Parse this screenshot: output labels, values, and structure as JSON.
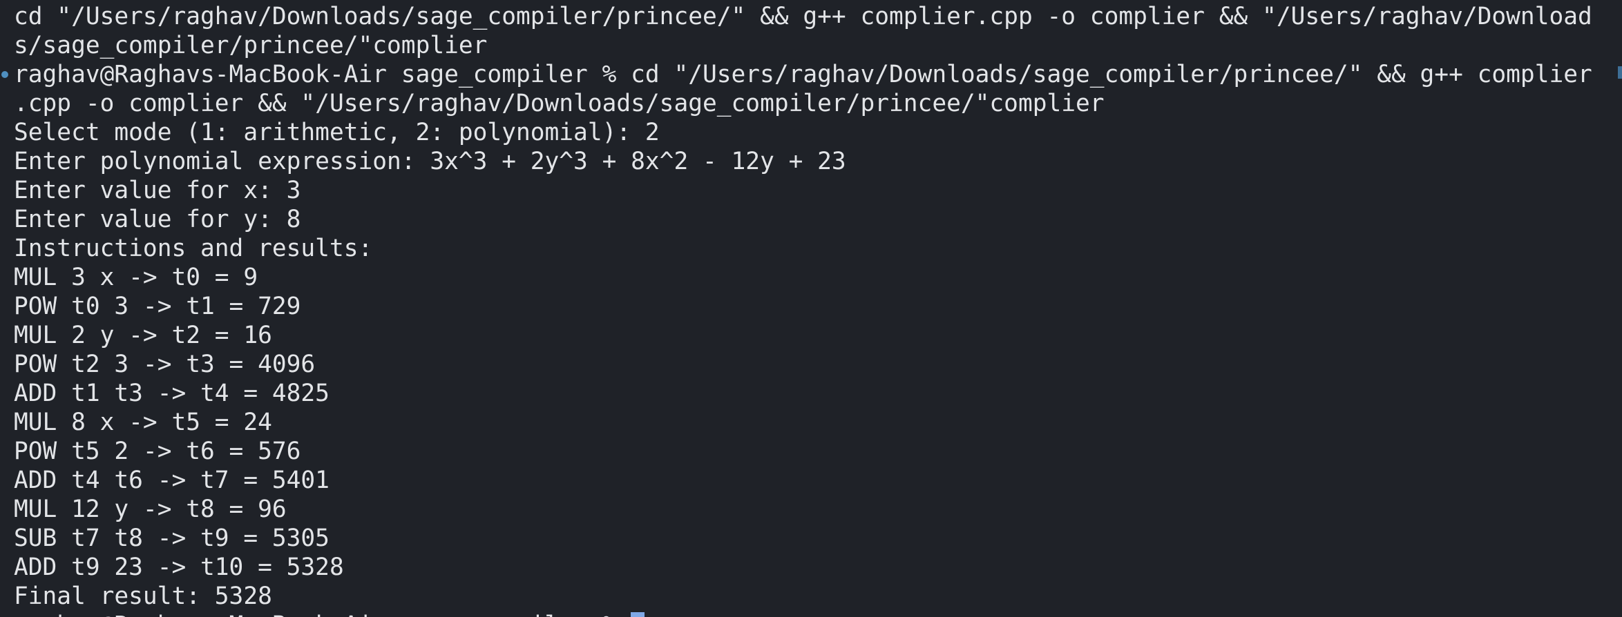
{
  "terminal": {
    "lines": [
      "cd \"/Users/raghav/Downloads/sage_compiler/princee/\" && g++ complier.cpp -o complier && \"/Users/raghav/Download",
      "s/sage_compiler/princee/\"complier",
      "raghav@Raghavs-MacBook-Air sage_compiler % cd \"/Users/raghav/Downloads/sage_compiler/princee/\" && g++ complier",
      ".cpp -o complier && \"/Users/raghav/Downloads/sage_compiler/princee/\"complier",
      "Select mode (1: arithmetic, 2: polynomial): 2",
      "Enter polynomial expression: 3x^3 + 2y^3 + 8x^2 - 12y + 23",
      "Enter value for x: 3",
      "Enter value for y: 8",
      "Instructions and results:",
      "MUL 3 x -> t0 = 9",
      "POW t0 3 -> t1 = 729",
      "MUL 2 y -> t2 = 16",
      "POW t2 3 -> t3 = 4096",
      "ADD t1 t3 -> t4 = 4825",
      "MUL 8 x -> t5 = 24",
      "POW t5 2 -> t6 = 576",
      "ADD t4 t6 -> t7 = 5401",
      "MUL 12 y -> t8 = 96",
      "SUB t7 t8 -> t9 = 5305",
      "ADD t9 23 -> t10 = 5328",
      "Final result: 5328"
    ],
    "prompt": "raghav@Raghavs-MacBook-Air sage_compiler % "
  },
  "colors": {
    "background": "#1f2228",
    "foreground": "#e3e5e8",
    "cursor": "#7fa8e6",
    "marker": "#4f8fbf"
  }
}
